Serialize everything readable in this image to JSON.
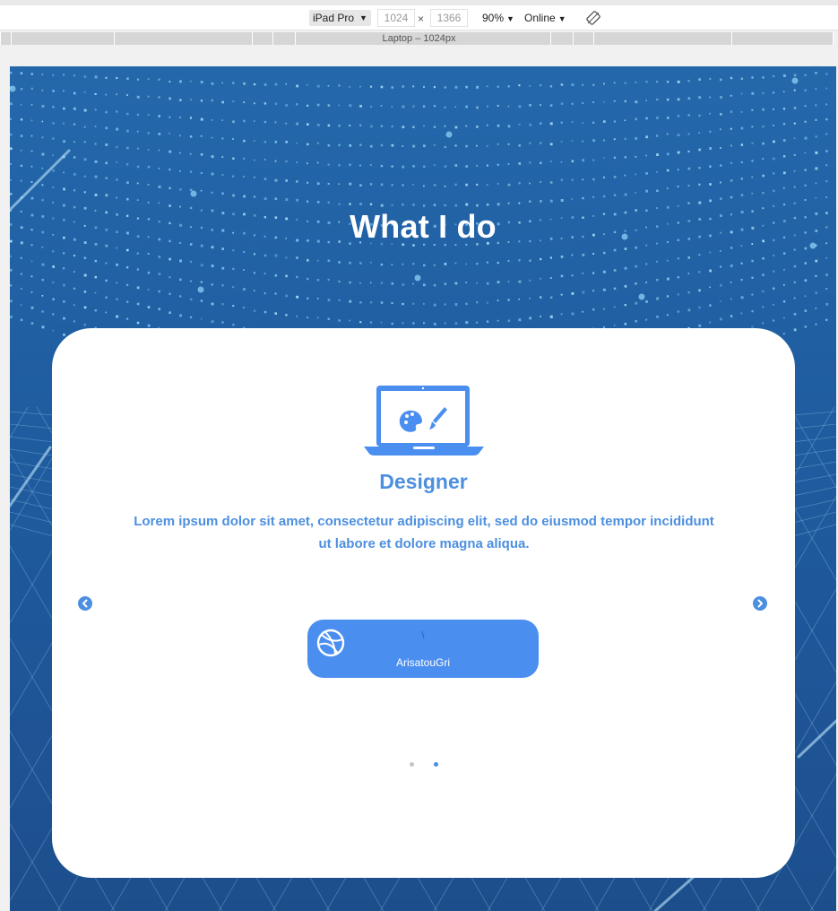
{
  "devtools": {
    "device": "iPad Pro",
    "width": "1024",
    "height": "1366",
    "times": "×",
    "zoom": "90%",
    "network": "Online",
    "media_label": "Laptop – 1024px"
  },
  "section": {
    "title": "What I do"
  },
  "card": {
    "icon": "laptop-palette-icon",
    "role_title": "Designer",
    "description": "Lorem ipsum dolor sit amet, consectetur adipiscing elit, sed do eiusmod tempor incididunt ut labore et dolore magna aliqua.",
    "social": {
      "icon": "dribbble-icon",
      "handle": "ArisatouGri"
    },
    "prev_icon": "chevron-left-icon",
    "next_icon": "chevron-right-icon",
    "dots": [
      "inactive",
      "active"
    ]
  },
  "colors": {
    "background_top": "#2468ab",
    "background_bottom": "#1d4e8c",
    "accent": "#4c8fe0",
    "button": "#4a8ef0",
    "card": "#ffffff"
  }
}
